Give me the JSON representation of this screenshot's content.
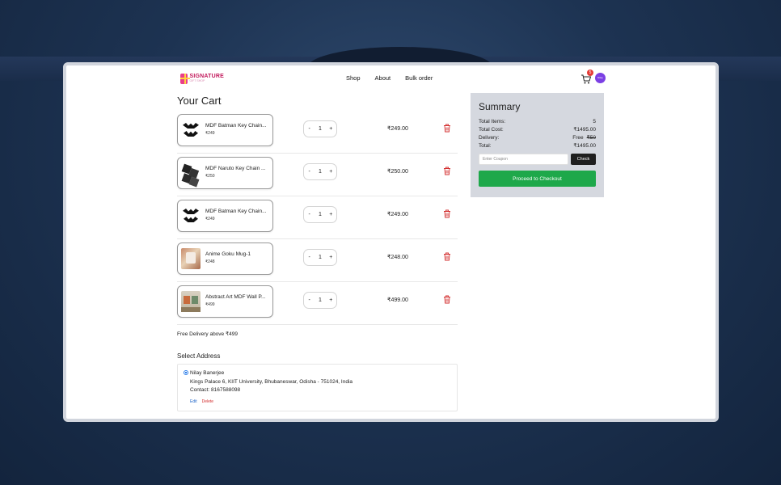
{
  "nav": {
    "logo_text": "SIGNATURE",
    "logo_sub": "GIFT SHOP",
    "links": [
      "Shop",
      "About",
      "Bulk order"
    ],
    "cart_count": "5",
    "avatar_text": "Nilay"
  },
  "cart": {
    "title": "Your Cart",
    "items": [
      {
        "name": "MDF Batman Key Chain...",
        "price": "₹249",
        "qty": "1",
        "total": "₹249.00",
        "minus": "-",
        "plus": "+"
      },
      {
        "name": "MDF Naruto Key Chain ...",
        "price": "₹250",
        "qty": "1",
        "total": "₹250.00",
        "minus": "-",
        "plus": "+"
      },
      {
        "name": "MDF Batman Key Chain...",
        "price": "₹249",
        "qty": "1",
        "total": "₹249.00",
        "minus": "-",
        "plus": "+"
      },
      {
        "name": "Anime Goku Mug-1",
        "price": "₹248",
        "qty": "1",
        "total": "₹248.00",
        "minus": "-",
        "plus": "+"
      },
      {
        "name": "Abstract Art MDF Wall P...",
        "price": "₹499",
        "qty": "1",
        "total": "₹499.00",
        "minus": "-",
        "plus": "+"
      }
    ],
    "free_delivery_note": "Free Delivery above ₹499"
  },
  "address": {
    "title": "Select Address",
    "name": "Nilay Banerjee",
    "line": "Kings Palace 6, KIIT University, Bhubaneswar, Odisha - 751024, India",
    "contact": "Contact: 8167588098",
    "edit_label": "Edit",
    "delete_label": "Delete"
  },
  "summary": {
    "title": "Summary",
    "total_items_label": "Total Items:",
    "total_items_value": "5",
    "total_cost_label": "Total Cost:",
    "total_cost_value": "₹1495.00",
    "delivery_label": "Delivery:",
    "delivery_free": "Free",
    "delivery_original": "₹50",
    "total_label": "Total:",
    "total_value": "₹1495.00",
    "coupon_placeholder": "Enter Coupon",
    "check_label": "Check",
    "checkout_label": "Proceed to Checkout"
  },
  "colors": {
    "checkout_green": "#1ea84a",
    "delete_red": "#d32f2f",
    "summary_bg": "#d5d8df",
    "badge_red": "#e53935",
    "avatar_purple": "#7b3fe4"
  }
}
